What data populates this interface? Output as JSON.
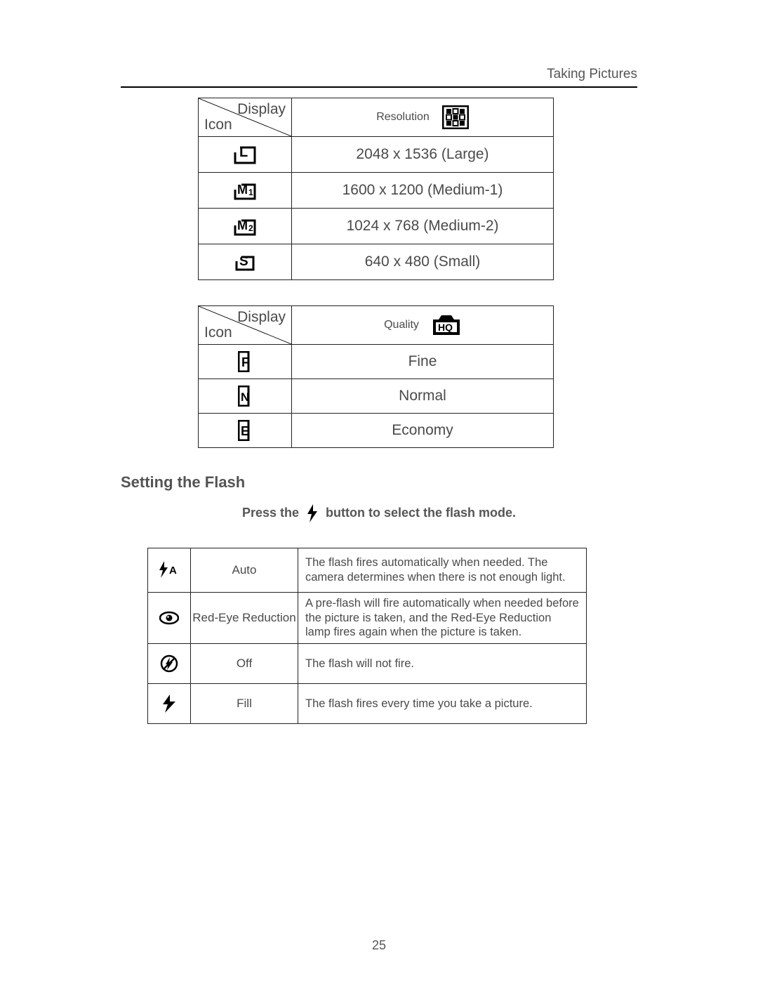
{
  "header": {
    "section": "Taking Pictures"
  },
  "diag": {
    "top": "Display",
    "bottom": "Icon"
  },
  "table_resolution": {
    "header_label": "Resolution",
    "header_icon": "resolution-grid-icon",
    "rows": [
      {
        "icon": "size-large-icon",
        "label": "2048 x 1536 (Large)"
      },
      {
        "icon": "size-medium1-icon",
        "label": "1600 x 1200 (Medium-1)"
      },
      {
        "icon": "size-medium2-icon",
        "label": "1024 x 768 (Medium-2)"
      },
      {
        "icon": "size-small-icon",
        "label": "640 x 480 (Small)"
      }
    ]
  },
  "table_quality": {
    "header_label": "Quality",
    "header_icon": "hq-camera-icon",
    "rows": [
      {
        "icon": "quality-fine-icon",
        "label": "Fine"
      },
      {
        "icon": "quality-normal-icon",
        "label": "Normal"
      },
      {
        "icon": "quality-economy-icon",
        "label": "Economy"
      }
    ]
  },
  "flash_section": {
    "heading": "Setting the Flash",
    "instruction_before": "Press the",
    "instruction_after": "button to select the flash mode.",
    "button_icon": "flash-bolt-icon",
    "rows": [
      {
        "icon": "flash-auto-icon",
        "mode": "Auto",
        "desc": "The flash fires automatically when needed.\nThe camera determines when there is not enough light."
      },
      {
        "icon": "flash-redeye-icon",
        "mode": "Red-Eye Reduction",
        "desc": "A pre-flash will fire automatically when needed before the picture is taken, and the Red-Eye Reduction lamp fires again when the picture is taken."
      },
      {
        "icon": "flash-off-icon",
        "mode": "Off",
        "desc": "The flash will not fire."
      },
      {
        "icon": "flash-fill-icon",
        "mode": "Fill",
        "desc": "The flash fires every time you take a picture."
      }
    ]
  },
  "page_number": "25"
}
